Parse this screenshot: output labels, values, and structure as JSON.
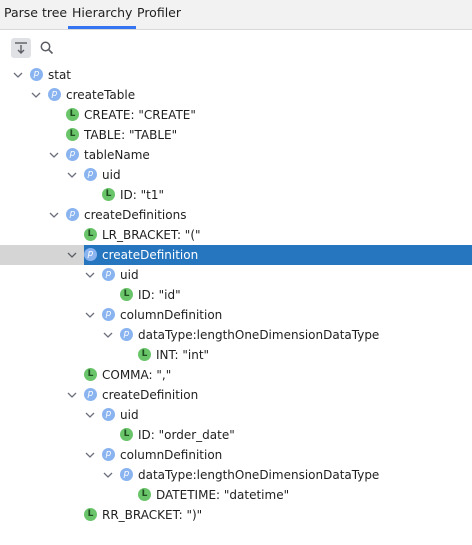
{
  "tabs": [
    {
      "label": "Parse tree",
      "active": false
    },
    {
      "label": "Hierarchy",
      "active": true
    },
    {
      "label": "Profiler",
      "active": false
    }
  ],
  "toolbar": {
    "buttons": [
      {
        "icon": "scroll-to-source-icon",
        "pressed": true
      },
      {
        "icon": "search-icon",
        "pressed": false
      }
    ]
  },
  "colors": {
    "selection": "#2675bf",
    "tab_underline": "#3574f0",
    "parser_badge": "#8ab4f0",
    "lexer_badge": "#69c46a"
  },
  "tree": [
    {
      "depth": 0,
      "kind": "p",
      "expanded": true,
      "label": "stat"
    },
    {
      "depth": 1,
      "kind": "p",
      "expanded": true,
      "label": "createTable"
    },
    {
      "depth": 2,
      "kind": "l",
      "expanded": null,
      "label": "CREATE: \"CREATE\""
    },
    {
      "depth": 2,
      "kind": "l",
      "expanded": null,
      "label": "TABLE: \"TABLE\""
    },
    {
      "depth": 2,
      "kind": "p",
      "expanded": true,
      "label": "tableName"
    },
    {
      "depth": 3,
      "kind": "p",
      "expanded": true,
      "label": "uid"
    },
    {
      "depth": 4,
      "kind": "l",
      "expanded": null,
      "label": "ID: \"t1\""
    },
    {
      "depth": 2,
      "kind": "p",
      "expanded": true,
      "label": "createDefinitions"
    },
    {
      "depth": 3,
      "kind": "l",
      "expanded": null,
      "label": "LR_BRACKET: \"(\""
    },
    {
      "depth": 3,
      "kind": "p",
      "expanded": true,
      "label": "createDefinition",
      "selected": true
    },
    {
      "depth": 4,
      "kind": "p",
      "expanded": true,
      "label": "uid"
    },
    {
      "depth": 5,
      "kind": "l",
      "expanded": null,
      "label": "ID: \"id\""
    },
    {
      "depth": 4,
      "kind": "p",
      "expanded": true,
      "label": "columnDefinition"
    },
    {
      "depth": 5,
      "kind": "p",
      "expanded": true,
      "label": "dataType:lengthOneDimensionDataType"
    },
    {
      "depth": 6,
      "kind": "l",
      "expanded": null,
      "label": "INT: \"int\""
    },
    {
      "depth": 3,
      "kind": "l",
      "expanded": null,
      "label": "COMMA: \",\""
    },
    {
      "depth": 3,
      "kind": "p",
      "expanded": true,
      "label": "createDefinition"
    },
    {
      "depth": 4,
      "kind": "p",
      "expanded": true,
      "label": "uid"
    },
    {
      "depth": 5,
      "kind": "l",
      "expanded": null,
      "label": "ID: \"order_date\""
    },
    {
      "depth": 4,
      "kind": "p",
      "expanded": true,
      "label": "columnDefinition"
    },
    {
      "depth": 5,
      "kind": "p",
      "expanded": true,
      "label": "dataType:lengthOneDimensionDataType"
    },
    {
      "depth": 6,
      "kind": "l",
      "expanded": null,
      "label": "DATETIME: \"datetime\""
    },
    {
      "depth": 3,
      "kind": "l",
      "expanded": null,
      "label": "RR_BRACKET: \")\""
    }
  ]
}
